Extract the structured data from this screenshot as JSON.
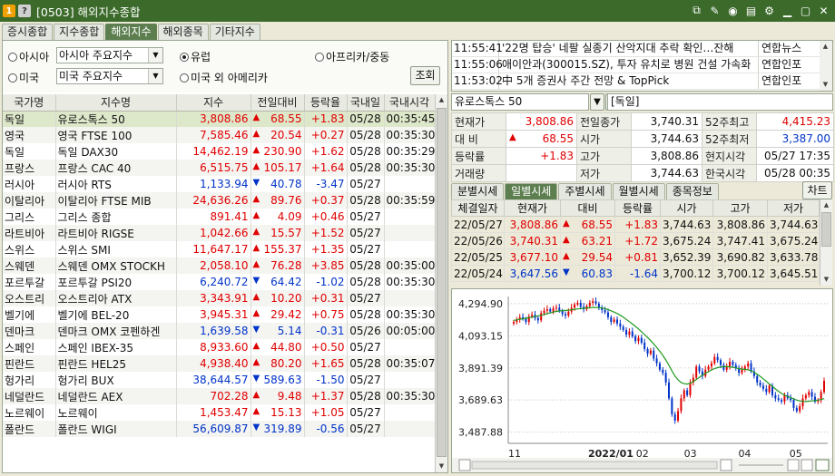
{
  "window": {
    "badge1": "1",
    "badge2": "?",
    "title": "[0503] 해외지수종합"
  },
  "tabs": [
    {
      "label": "증시종합"
    },
    {
      "label": "지수종합"
    },
    {
      "label": "해외지수"
    },
    {
      "label": "해외종목"
    },
    {
      "label": "기타지수"
    }
  ],
  "filters": {
    "asia": "아시아",
    "asia_select": "아시아 주요지수",
    "europe": "유럽",
    "africa": "아프리카/중동",
    "america": "미국",
    "america_select": "미국 주요지수",
    "other_america": "미국 외 아메리카",
    "search": "조회"
  },
  "grid": {
    "headers": [
      "국가명",
      "지수명",
      "지수",
      "전일대비",
      "등락율",
      "국내일",
      "국내시각"
    ],
    "rows": [
      [
        "독일",
        "유로스톡스 50",
        "3,808.86",
        "up",
        "68.55",
        "+1.83",
        "05/28",
        "00:35:45"
      ],
      [
        "영국",
        "영국 FTSE 100",
        "7,585.46",
        "up",
        "20.54",
        "+0.27",
        "05/28",
        "00:35:30"
      ],
      [
        "독일",
        "독일 DAX30",
        "14,462.19",
        "up",
        "230.90",
        "+1.62",
        "05/28",
        "00:35:29"
      ],
      [
        "프랑스",
        "프랑스 CAC 40",
        "6,515.75",
        "up",
        "105.17",
        "+1.64",
        "05/28",
        "00:35:30"
      ],
      [
        "러시아",
        "러시아 RTS",
        "1,133.94",
        "dn",
        "40.78",
        "-3.47",
        "05/27",
        ""
      ],
      [
        "이탈리아",
        "이탈리아 FTSE MIB",
        "24,636.26",
        "up",
        "89.76",
        "+0.37",
        "05/28",
        "00:35:59"
      ],
      [
        "그리스",
        "그리스 종합",
        "891.41",
        "up",
        "4.09",
        "+0.46",
        "05/27",
        ""
      ],
      [
        "라트비아",
        "라트비아 RIGSE",
        "1,042.66",
        "up",
        "15.57",
        "+1.52",
        "05/27",
        ""
      ],
      [
        "스위스",
        "스위스 SMI",
        "11,647.17",
        "up",
        "155.37",
        "+1.35",
        "05/27",
        ""
      ],
      [
        "스웨덴",
        "스웨덴 OMX STOCKH",
        "2,058.10",
        "up",
        "76.28",
        "+3.85",
        "05/28",
        "00:35:00"
      ],
      [
        "포르투갈",
        "포르투갈 PSI20",
        "6,240.72",
        "dn",
        "64.42",
        "-1.02",
        "05/28",
        "00:35:30"
      ],
      [
        "오스트리",
        "오스트리아 ATX",
        "3,343.91",
        "up",
        "10.20",
        "+0.31",
        "05/27",
        ""
      ],
      [
        "벨기에",
        "벨기에 BEL-20",
        "3,945.31",
        "up",
        "29.42",
        "+0.75",
        "05/28",
        "00:35:30"
      ],
      [
        "덴마크",
        "덴마크 OMX 코펜하겐",
        "1,639.58",
        "dn",
        "5.14",
        "-0.31",
        "05/26",
        "00:05:00"
      ],
      [
        "스페인",
        "스페인 IBEX-35",
        "8,933.60",
        "up",
        "44.80",
        "+0.50",
        "05/27",
        ""
      ],
      [
        "핀란드",
        "핀란드 HEL25",
        "4,938.40",
        "up",
        "80.20",
        "+1.65",
        "05/28",
        "00:35:07"
      ],
      [
        "헝가리",
        "헝가리 BUX",
        "38,644.57",
        "dn",
        "589.63",
        "-1.50",
        "05/27",
        ""
      ],
      [
        "네덜란드",
        "네덜란드 AEX",
        "702.28",
        "up",
        "9.48",
        "+1.37",
        "05/28",
        "00:35:30"
      ],
      [
        "노르웨이",
        "노르웨이",
        "1,453.47",
        "up",
        "15.13",
        "+1.05",
        "05/27",
        ""
      ],
      [
        "폴란드",
        "폴란드 WIGI",
        "56,609.87",
        "dn",
        "319.89",
        "-0.56",
        "05/27",
        ""
      ]
    ]
  },
  "news": [
    {
      "time": "11:55:41",
      "title": "'22명 탑승' 네팔 실종기 산악지대 추락 확인…잔해",
      "src": "연합뉴스"
    },
    {
      "time": "11:55:06",
      "title": "애이안과(300015.SZ), 투자 유치로 병원 건설 가속화",
      "src": "연합인포"
    },
    {
      "time": "11:53:02",
      "title": "中 5개 증권사 주간 전망 & TopPick",
      "src": "연합인포"
    }
  ],
  "index_box": {
    "name": "유로스톡스 50",
    "country": "[독일]"
  },
  "quote": {
    "rows": [
      [
        "현재가",
        "3,808.86",
        "전일종가",
        "3,740.31",
        "52주최고",
        "4,415.23"
      ],
      [
        "대 비",
        "68.55",
        "시가",
        "3,744.63",
        "52주최저",
        "3,387.00"
      ],
      [
        "등락률",
        "+1.83",
        "고가",
        "3,808.86",
        "현지시각",
        "05/27 17:35"
      ],
      [
        "거래량",
        "",
        "저가",
        "3,744.63",
        "한국시각",
        "05/28 00:35"
      ]
    ]
  },
  "subtabs": [
    {
      "label": "분별시세"
    },
    {
      "label": "일별시세"
    },
    {
      "label": "주별시세"
    },
    {
      "label": "월별시세"
    },
    {
      "label": "종목정보"
    }
  ],
  "chart_btn": "차트",
  "daily": {
    "headers": [
      "체결일자",
      "현재가",
      "대비",
      "등락률",
      "시가",
      "고가",
      "저가"
    ],
    "rows": [
      [
        "22/05/27",
        "3,808.86",
        "up",
        "68.55",
        "+1.83",
        "3,744.63",
        "3,808.86",
        "3,744.63"
      ],
      [
        "22/05/26",
        "3,740.31",
        "up",
        "63.21",
        "+1.72",
        "3,675.24",
        "3,747.41",
        "3,675.24"
      ],
      [
        "22/05/25",
        "3,677.10",
        "up",
        "29.54",
        "+0.81",
        "3,652.39",
        "3,690.82",
        "3,633.78"
      ],
      [
        "22/05/24",
        "3,647.56",
        "dn",
        "60.83",
        "-1.64",
        "3,700.12",
        "3,700.12",
        "3,645.51"
      ]
    ]
  },
  "chart_data": {
    "type": "candlestick",
    "yticks": [
      "4,294.90",
      "4,093.15",
      "3,891.39",
      "3,689.63",
      "3,487.88"
    ],
    "ylim": [
      3440,
      4340
    ],
    "xticks": [
      "11",
      "2022/01",
      "02",
      "03",
      "04",
      "05"
    ],
    "close": [
      4180,
      4195,
      4210,
      4200,
      4180,
      4215,
      4225,
      4205,
      4190,
      4235,
      4250,
      4260,
      4245,
      4265,
      4270,
      4250,
      4230,
      4220,
      4245,
      4270,
      4290,
      4300,
      4275,
      4260,
      4280,
      4300,
      4310,
      4295,
      4270,
      4255,
      4240,
      4210,
      4180,
      4195,
      4170,
      4150,
      4130,
      4100,
      4120,
      4090,
      4060,
      4080,
      4050,
      4010,
      3980,
      4000,
      3950,
      3920,
      3880,
      3860,
      3800,
      3700,
      3600,
      3560,
      3620,
      3700,
      3750,
      3720,
      3800,
      3830,
      3900,
      3870,
      3840,
      3880,
      3900,
      3920,
      3960,
      3940,
      3910,
      3880,
      3900,
      3930,
      3910,
      3890,
      3860,
      3880,
      3900,
      3920,
      3870,
      3840,
      3800,
      3780,
      3760,
      3740,
      3780,
      3720,
      3700,
      3690,
      3680,
      3720,
      3700,
      3690,
      3640,
      3620,
      3650,
      3700,
      3720,
      3740,
      3710,
      3680,
      3690,
      3740,
      3810
    ],
    "ma": [
      4190,
      4193,
      4197,
      4200,
      4203,
      4207,
      4210,
      4214,
      4218,
      4222,
      4227,
      4232,
      4237,
      4242,
      4246,
      4249,
      4251,
      4252,
      4254,
      4256,
      4259,
      4262,
      4264,
      4266,
      4268,
      4270,
      4271,
      4271,
      4270,
      4268,
      4264,
      4258,
      4250,
      4242,
      4233,
      4222,
      4210,
      4196,
      4182,
      4167,
      4152,
      4136,
      4119,
      4101,
      4082,
      4063,
      4042,
      4020,
      3996,
      3970,
      3941,
      3908,
      3872,
      3840,
      3816,
      3800,
      3792,
      3790,
      3795,
      3805,
      3818,
      3832,
      3845,
      3857,
      3868,
      3878,
      3887,
      3893,
      3897,
      3899,
      3899,
      3898,
      3895,
      3891,
      3887,
      3884,
      3882,
      3879,
      3873,
      3864,
      3852,
      3838,
      3823,
      3807,
      3791,
      3775,
      3759,
      3744,
      3731,
      3720,
      3712,
      3705,
      3697,
      3689,
      3684,
      3681,
      3680,
      3682,
      3684,
      3686,
      3689,
      3693,
      3698
    ]
  }
}
